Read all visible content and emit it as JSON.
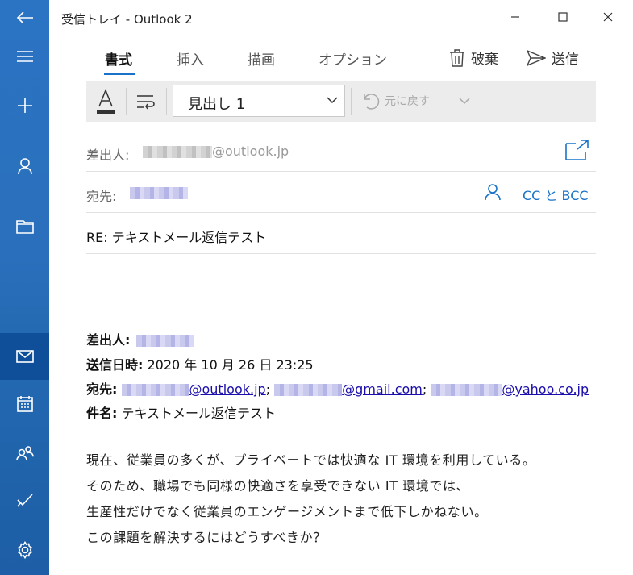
{
  "window": {
    "title": "受信トレイ - Outlook 2"
  },
  "tabs": [
    {
      "label": "書式",
      "active": true
    },
    {
      "label": "挿入",
      "active": false
    },
    {
      "label": "描画",
      "active": false
    },
    {
      "label": "オプション",
      "active": false
    }
  ],
  "actions": {
    "discard_label": "破棄",
    "send_label": "送信"
  },
  "toolbar": {
    "text_style_value": "見出し 1",
    "undo_label": "元に戻す"
  },
  "compose": {
    "from_label": "差出人:",
    "from_domain": "@outlook.jp",
    "to_label": "宛先:",
    "cc_bcc_label": "CC と BCC",
    "subject": "RE: テキストメール返信テスト"
  },
  "quoted": {
    "from_label": "差出人:",
    "sent_label": "送信日時:",
    "sent_value": "2020 年 10 月 26 日 23:25",
    "to_label": "宛先:",
    "recipients": [
      {
        "domain": "@outlook.jp"
      },
      {
        "domain": "@gmail.com"
      },
      {
        "domain": "@yahoo.co.jp"
      }
    ],
    "separator": ";",
    "subject_label": "件名:",
    "subject_value": "テキストメール返信テスト"
  },
  "body": [
    "現在、従業員の多くが、プライベートでは快適な IT 環境を利用している。",
    "そのため、職場でも同様の快適さを享受できない IT 環境では、",
    "生産性だけでなく従業員のエンゲージメントまで低下しかねない。",
    "この課題を解決するにはどうすべきか？"
  ],
  "icons": {
    "sidebar": [
      "back-arrow-icon",
      "hamburger-menu-icon",
      "plus-icon",
      "person-icon",
      "folder-icon",
      "mail-icon",
      "calendar-icon",
      "people-icon",
      "checkmark-icon",
      "gear-icon"
    ]
  },
  "colors": {
    "sidebar": "#2b74c4",
    "sidebar_active": "#0f4f9a",
    "accent": "#1a73c8",
    "link": "#1a0dab"
  }
}
